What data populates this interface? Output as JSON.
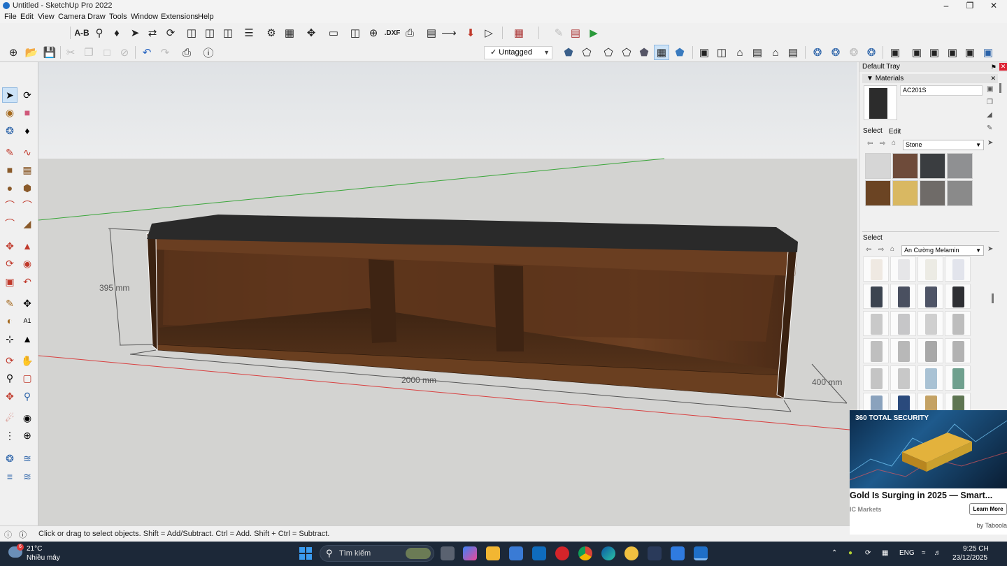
{
  "window": {
    "title": "Untitled - SketchUp Pro 2022"
  },
  "menu": [
    "File",
    "Edit",
    "View",
    "Camera",
    "Draw",
    "Tools",
    "Window",
    "Extensions",
    "Help"
  ],
  "toolbar": {
    "ab_label": "A-B",
    "dxf_label": ".DXF",
    "tag_selected": "Untagged"
  },
  "viewport": {
    "dimensions": {
      "height": "395 mm",
      "length": "2000 mm",
      "depth": "400 mm"
    },
    "colors": {
      "sky": "#e4e6e8",
      "ground": "#d2d2d0",
      "wood": "#5a351e",
      "top": "#2a2a2a",
      "red_axis": "#d84040",
      "green_axis": "#3aa63a"
    }
  },
  "tray": {
    "title": "Default Tray",
    "materials_panel": "Materials",
    "material_name": "AC201S",
    "tabs": {
      "select": "Select",
      "edit": "Edit"
    },
    "library1": "Stone",
    "stone_swatches": [
      "#d6d6d6",
      "#6e4b3a",
      "#3a3d40",
      "#8f9092",
      "#6b4423",
      "#d9b862",
      "#6f6b68",
      "#8a8a8a"
    ],
    "section2_label": "Select",
    "library2": "An Cường Melamin",
    "melamine_swatches": [
      "#efe9e2",
      "#e6e6e8",
      "#ecebe4",
      "#e2e4ec",
      "#3c4450",
      "#4a5060",
      "#4e5466",
      "#2e2f33",
      "#c9c9c9",
      "#c6c6c8",
      "#cfcfcf",
      "#bdbdbd",
      "#bfbfbf",
      "#b8b8b8",
      "#a8a8a8",
      "#b2b2b2",
      "#c4c4c4",
      "#c8c8c8",
      "#a9c2d4",
      "#6fa08e",
      "#8aa2bd",
      "#2a4a7c",
      "#c4a264",
      "#5e7552"
    ]
  },
  "ad": {
    "brand": "360 TOTAL SECURITY",
    "headline": "Gold Is Surging in 2025 — Smart...",
    "source": "IC Markets",
    "cta": "Learn More",
    "by": "by Taboola"
  },
  "status": {
    "text": "Click or drag to select objects. Shift = Add/Subtract. Ctrl = Add. Shift + Ctrl = Subtract."
  },
  "taskbar": {
    "weather_temp": "21°C",
    "weather_desc": "Nhiều mây",
    "weather_badge": "6",
    "search_placeholder": "Tìm kiếm",
    "language": "ENG",
    "time": "9:25 CH",
    "date": "23/12/2025"
  }
}
